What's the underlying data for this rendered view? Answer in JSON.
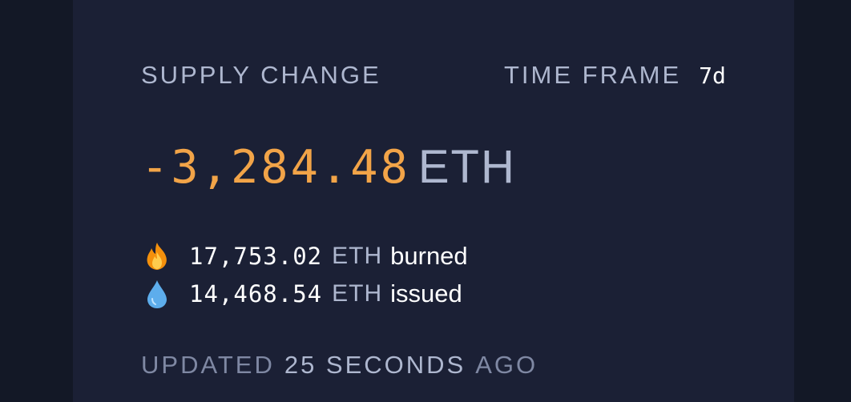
{
  "supply": {
    "label": "SUPPLY CHANGE",
    "amount": "-3,284.48",
    "unit": "ETH"
  },
  "time_frame": {
    "label": "TIME FRAME",
    "value": "7d"
  },
  "burned": {
    "icon": "fire-icon",
    "amount": "17,753.02",
    "unit": "ETH",
    "label": "burned"
  },
  "issued": {
    "icon": "droplet-icon",
    "amount": "14,468.54",
    "unit": "ETH",
    "label": "issued"
  },
  "updated": {
    "prefix": "UPDATED",
    "value": "25 SECONDS",
    "suffix": "AGO"
  },
  "colors": {
    "background": "#131826",
    "card": "#1b2035",
    "amount_orange": "#f2a448",
    "label_gray": "#aeb7cf"
  }
}
